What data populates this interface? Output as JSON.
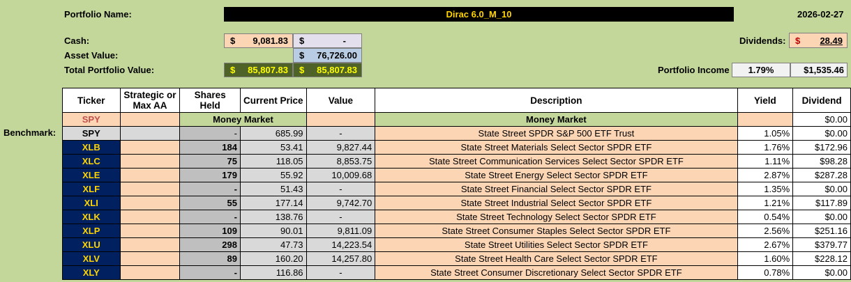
{
  "header": {
    "portfolio_name_label": "Portfolio Name:",
    "portfolio_name": "Dirac 6.0_M_10",
    "date": "2026-02-27",
    "cash_label": "Cash:",
    "asset_value_label": "Asset Value:",
    "total_label": "Total Portfolio Value:",
    "currency": "$",
    "cash_value": "9,081.83",
    "cash_value2": "-",
    "asset_value": "76,726.00",
    "total_value1": "85,807.83",
    "total_value2": "85,807.83",
    "dividends_label": "Dividends:",
    "dividends_value": "28.49",
    "income_label": "Portfolio Income",
    "income_pct": "1.79%",
    "income_value": "$1,535.46",
    "benchmark_label": "Benchmark:"
  },
  "columns": {
    "ticker": "Ticker",
    "strategic_1": "Strategic or",
    "strategic_2": "Max AA",
    "shares_1": "Shares",
    "shares_2": "Held",
    "price": "Current Price",
    "value": "Value",
    "description": "Description",
    "yield": "Yield",
    "dividend": "Dividend"
  },
  "money_market_row": {
    "ticker": "SPY",
    "label": "Money Market",
    "description": "Money Market",
    "dividend": "$0.00"
  },
  "benchmark_row": {
    "ticker": "SPY",
    "shares": "-",
    "price": "685.99",
    "value": "-",
    "description": "State Street SPDR S&P 500 ETF Trust",
    "yield": "1.05%",
    "dividend": "$0.00"
  },
  "holdings": [
    {
      "ticker": "XLB",
      "shares": "184",
      "price": "53.41",
      "value": "9,827.44",
      "description": "State Street Materials Select Sector SPDR ETF",
      "yield": "1.76%",
      "dividend": "$172.96"
    },
    {
      "ticker": "XLC",
      "shares": "75",
      "price": "118.05",
      "value": "8,853.75",
      "description": "State Street Communication Services Select Sector SPDR ETF",
      "yield": "1.11%",
      "dividend": "$98.28"
    },
    {
      "ticker": "XLE",
      "shares": "179",
      "price": "55.92",
      "value": "10,009.68",
      "description": "State Street Energy Select Sector SPDR ETF",
      "yield": "2.87%",
      "dividend": "$287.28"
    },
    {
      "ticker": "XLF",
      "shares": "-",
      "price": "51.43",
      "value": "-",
      "description": "State Street Financial Select Sector SPDR ETF",
      "yield": "1.35%",
      "dividend": "$0.00"
    },
    {
      "ticker": "XLI",
      "shares": "55",
      "price": "177.14",
      "value": "9,742.70",
      "description": "State Street Industrial Select Sector SPDR ETF",
      "yield": "1.21%",
      "dividend": "$117.89"
    },
    {
      "ticker": "XLK",
      "shares": "-",
      "price": "138.76",
      "value": "-",
      "description": "State Street Technology Select Sector SPDR ETF",
      "yield": "0.54%",
      "dividend": "$0.00"
    },
    {
      "ticker": "XLP",
      "shares": "109",
      "price": "90.01",
      "value": "9,811.09",
      "description": "State Street Consumer Staples Select Sector SPDR ETF",
      "yield": "2.56%",
      "dividend": "$251.16"
    },
    {
      "ticker": "XLU",
      "shares": "298",
      "price": "47.73",
      "value": "14,223.54",
      "description": "State Street Utilities Select Sector SPDR ETF",
      "yield": "2.67%",
      "dividend": "$379.77"
    },
    {
      "ticker": "XLV",
      "shares": "89",
      "price": "160.20",
      "value": "14,257.80",
      "description": "State Street Health Care Select Sector SPDR ETF",
      "yield": "1.60%",
      "dividend": "$228.12"
    },
    {
      "ticker": "XLY",
      "shares": "-",
      "price": "116.86",
      "value": "-",
      "description": "State Street Consumer Discretionary Select Sector SPDR ETF",
      "yield": "0.78%",
      "dividend": "$0.00"
    }
  ],
  "colors": {
    "background": "#c4d79b",
    "ticker_bg": "#002060",
    "ticker_text": "#ffd400",
    "peach": "#fcd5b4",
    "total_bg": "#4f6228",
    "total_text": "#ffff00",
    "asset_bg": "#b8cce4"
  }
}
